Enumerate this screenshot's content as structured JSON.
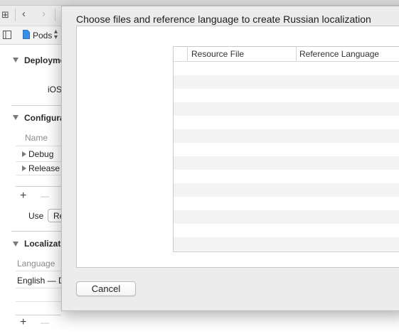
{
  "toolbar": {
    "grid_icon": "grid-icon",
    "back_icon": "chevron-left-icon",
    "forward_icon": "chevron-right-icon"
  },
  "jumpbar": {
    "sidebar_icon": "sidebar-toggle-icon",
    "file_icon": "document-icon",
    "project_label": "Pods"
  },
  "background": {
    "deployment_title": "Deployme",
    "ios_label": "iOS",
    "configurations_title": "Configura",
    "name_header": "Name",
    "configurations": [
      "Debug",
      "Release"
    ],
    "use_label": "Use",
    "use_value": "Re",
    "localizations_title": "Localizati",
    "language_header": "Language",
    "languages": [
      "English — D"
    ],
    "add_symbol": "+",
    "remove_symbol": "—"
  },
  "dialog": {
    "title": "Choose files and reference language to create Russian localization",
    "columns": [
      "Resource File",
      "Reference Language"
    ],
    "rows": [],
    "cancel_label": "Cancel"
  }
}
